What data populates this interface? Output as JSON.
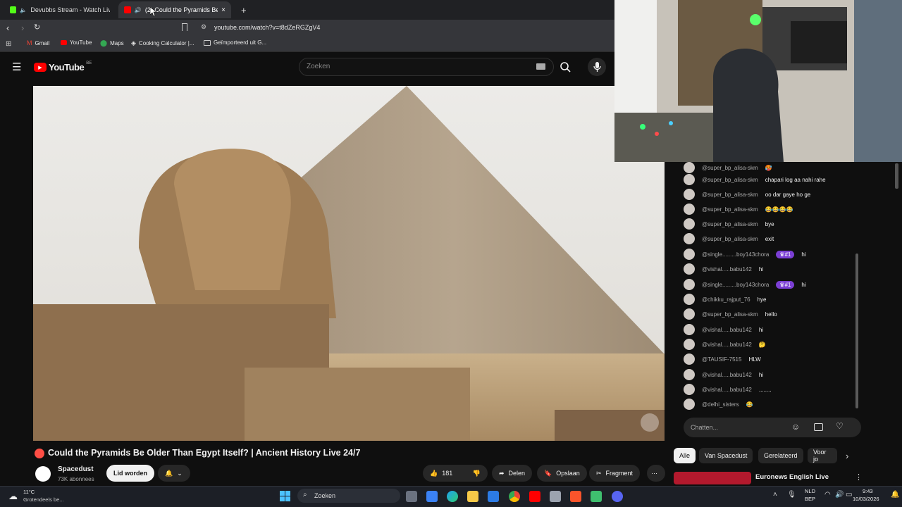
{
  "browser": {
    "tabs": [
      {
        "title": "Devubbs Stream - Watch Live on",
        "favicon_color": "#53fc18"
      },
      {
        "title": "(2) Could the Pyramids Be",
        "favicon_color": "#ff0000"
      }
    ],
    "new_tab": "+",
    "url": "youtube.com/watch?v=t8dZeRGZgV4",
    "bookmarks": [
      "Gmail",
      "YouTube",
      "Maps",
      "Cooking Calculator |...",
      "Geïmporteerd uit G..."
    ]
  },
  "youtube": {
    "logo_text": "YouTube",
    "region": "BE",
    "search_placeholder": "Zoeken"
  },
  "video": {
    "title": "Could the Pyramids Be Older Than Egypt Itself? | Ancient History Live 24/7",
    "live_dot_color": "#ff4e45",
    "channel": "Spacedust",
    "subscribers": "73K abonnees",
    "join_label": "Lid worden",
    "likes": "181",
    "share_label": "Delen",
    "save_label": "Opslaan",
    "clip_label": "Fragment"
  },
  "chat": {
    "messages": [
      {
        "user": "@super_bp_alisa-skm",
        "text": "🥵"
      },
      {
        "user": "@super_bp_alisa-skm",
        "text": "chapari log aa nahi rahe"
      },
      {
        "user": "@super_bp_alisa-skm",
        "text": "oo dar gaye ho ge"
      },
      {
        "user": "@super_bp_alisa-skm",
        "text": "😂😂😂😂"
      },
      {
        "user": "@super_bp_alisa-skm",
        "text": "bye"
      },
      {
        "user": "@super_bp_alisa-skm",
        "text": "exit"
      },
      {
        "user": "@single.........boy143chora",
        "badge": "♛#1",
        "text": "hi"
      },
      {
        "user": "@vishal.....babu142",
        "text": "hi"
      },
      {
        "user": "@single.........boy143chora",
        "badge": "♛#1",
        "text": "hi"
      },
      {
        "user": "@chikku_rajput_76",
        "text": "hye"
      },
      {
        "user": "@super_bp_alisa-skm",
        "text": "hello"
      },
      {
        "user": "@vishal.....babu142",
        "text": "hi"
      },
      {
        "user": "@vishal.....babu142",
        "text": "🤔"
      },
      {
        "user": "@TAUSIF-7515",
        "text": "HLW"
      },
      {
        "user": "@vishal.....babu142",
        "text": "hi"
      },
      {
        "user": "@vishal.....babu142",
        "text": "........"
      },
      {
        "user": "@delhi_sisters",
        "text": "😂"
      }
    ],
    "input_placeholder": "Chatten..."
  },
  "chips": [
    "Alle",
    "Van Spacedust",
    "Gerelateerd",
    "Voor jo"
  ],
  "related": {
    "title": "Euronews English Live"
  },
  "taskbar": {
    "temperature": "11°C",
    "weather": "Grotendeels be...",
    "search_placeholder": "Zoeken",
    "lang": "NLD",
    "layout": "BEP",
    "time": "9:43",
    "date": "10/03/2026"
  }
}
